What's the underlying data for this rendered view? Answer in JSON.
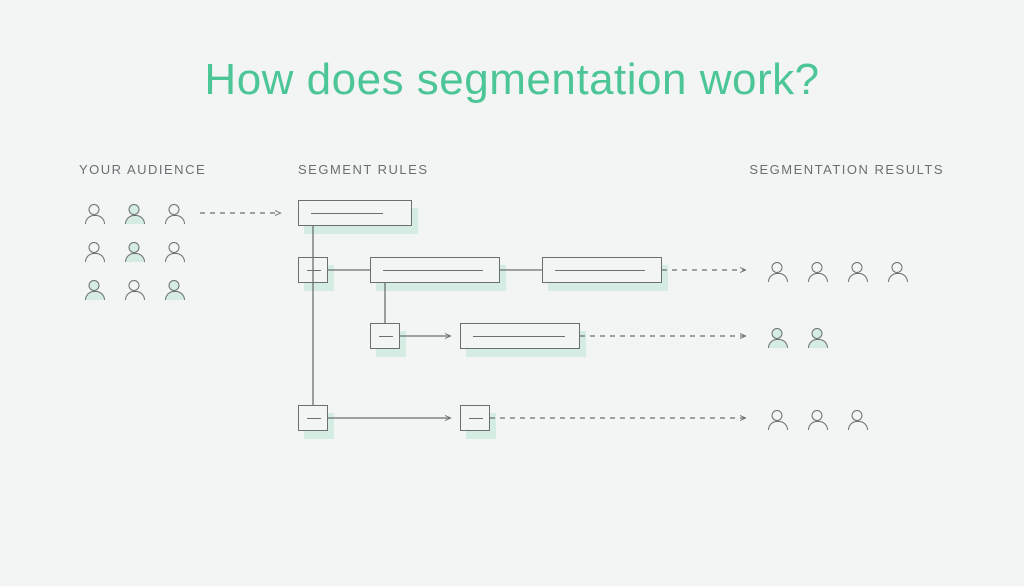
{
  "title": "How does segmentation work?",
  "labels": {
    "audience": "YOUR AUDIENCE",
    "rules": "SEGMENT RULES",
    "results": "SEGMENTATION RESULTS"
  }
}
